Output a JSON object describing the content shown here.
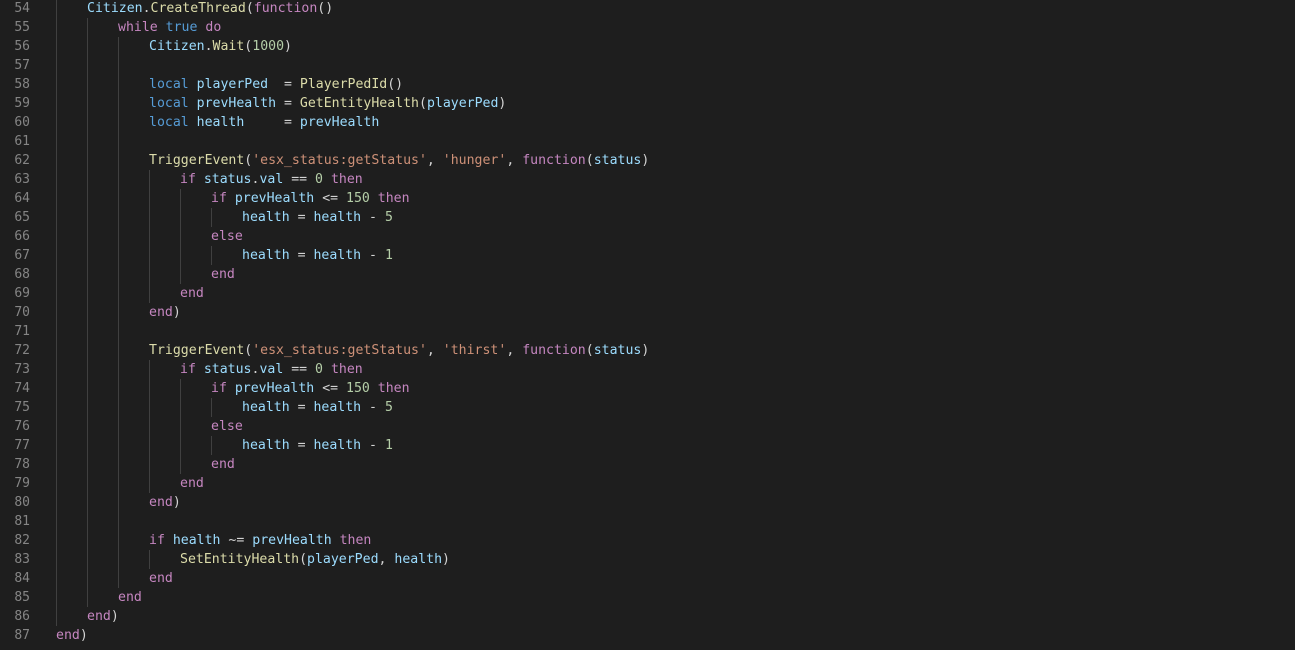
{
  "editor": {
    "theme": {
      "background": "#1e1e1e",
      "line_number": "#858585",
      "keyword": "#c586c0",
      "declaration": "#569cd6",
      "function": "#dcdcaa",
      "variable": "#9cdcfe",
      "string": "#ce9178",
      "number": "#b5cea8",
      "punctuation": "#d4d4d4"
    },
    "lines": [
      {
        "n": "54",
        "indent": 1,
        "tokens": [
          {
            "t": "Citizen",
            "c": "var"
          },
          {
            "t": ".",
            "c": "p"
          },
          {
            "t": "CreateThread",
            "c": "fn"
          },
          {
            "t": "(",
            "c": "p"
          },
          {
            "t": "function",
            "c": "kw"
          },
          {
            "t": "()",
            "c": "p"
          }
        ]
      },
      {
        "n": "55",
        "indent": 2,
        "tokens": [
          {
            "t": "while",
            "c": "kw"
          },
          {
            "t": " ",
            "c": "p"
          },
          {
            "t": "true",
            "c": "dec"
          },
          {
            "t": " ",
            "c": "p"
          },
          {
            "t": "do",
            "c": "kw"
          }
        ]
      },
      {
        "n": "56",
        "indent": 3,
        "tokens": [
          {
            "t": "Citizen",
            "c": "var"
          },
          {
            "t": ".",
            "c": "p"
          },
          {
            "t": "Wait",
            "c": "fn"
          },
          {
            "t": "(",
            "c": "p"
          },
          {
            "t": "1000",
            "c": "num"
          },
          {
            "t": ")",
            "c": "p"
          }
        ]
      },
      {
        "n": "57",
        "indent": 0,
        "tokens": []
      },
      {
        "n": "58",
        "indent": 3,
        "tokens": [
          {
            "t": "local",
            "c": "dec"
          },
          {
            "t": " ",
            "c": "p"
          },
          {
            "t": "playerPed",
            "c": "var"
          },
          {
            "t": "  = ",
            "c": "p"
          },
          {
            "t": "PlayerPedId",
            "c": "fn"
          },
          {
            "t": "()",
            "c": "p"
          }
        ]
      },
      {
        "n": "59",
        "indent": 3,
        "tokens": [
          {
            "t": "local",
            "c": "dec"
          },
          {
            "t": " ",
            "c": "p"
          },
          {
            "t": "prevHealth",
            "c": "var"
          },
          {
            "t": " = ",
            "c": "p"
          },
          {
            "t": "GetEntityHealth",
            "c": "fn"
          },
          {
            "t": "(",
            "c": "p"
          },
          {
            "t": "playerPed",
            "c": "var"
          },
          {
            "t": ")",
            "c": "p"
          }
        ]
      },
      {
        "n": "60",
        "indent": 3,
        "tokens": [
          {
            "t": "local",
            "c": "dec"
          },
          {
            "t": " ",
            "c": "p"
          },
          {
            "t": "health",
            "c": "var"
          },
          {
            "t": "     = ",
            "c": "p"
          },
          {
            "t": "prevHealth",
            "c": "var"
          }
        ]
      },
      {
        "n": "61",
        "indent": 0,
        "tokens": []
      },
      {
        "n": "62",
        "indent": 3,
        "tokens": [
          {
            "t": "TriggerEvent",
            "c": "fn"
          },
          {
            "t": "(",
            "c": "p"
          },
          {
            "t": "'esx_status:getStatus'",
            "c": "str"
          },
          {
            "t": ", ",
            "c": "p"
          },
          {
            "t": "'hunger'",
            "c": "str"
          },
          {
            "t": ", ",
            "c": "p"
          },
          {
            "t": "function",
            "c": "kw"
          },
          {
            "t": "(",
            "c": "p"
          },
          {
            "t": "status",
            "c": "var"
          },
          {
            "t": ")",
            "c": "p"
          }
        ]
      },
      {
        "n": "63",
        "indent": 4,
        "tokens": [
          {
            "t": "if",
            "c": "kw"
          },
          {
            "t": " ",
            "c": "p"
          },
          {
            "t": "status",
            "c": "var"
          },
          {
            "t": ".",
            "c": "p"
          },
          {
            "t": "val",
            "c": "var"
          },
          {
            "t": " == ",
            "c": "p"
          },
          {
            "t": "0",
            "c": "num"
          },
          {
            "t": " ",
            "c": "p"
          },
          {
            "t": "then",
            "c": "kw"
          }
        ]
      },
      {
        "n": "64",
        "indent": 5,
        "tokens": [
          {
            "t": "if",
            "c": "kw"
          },
          {
            "t": " ",
            "c": "p"
          },
          {
            "t": "prevHealth",
            "c": "var"
          },
          {
            "t": " <= ",
            "c": "p"
          },
          {
            "t": "150",
            "c": "num"
          },
          {
            "t": " ",
            "c": "p"
          },
          {
            "t": "then",
            "c": "kw"
          }
        ]
      },
      {
        "n": "65",
        "indent": 6,
        "tokens": [
          {
            "t": "health",
            "c": "var"
          },
          {
            "t": " = ",
            "c": "p"
          },
          {
            "t": "health",
            "c": "var"
          },
          {
            "t": " - ",
            "c": "p"
          },
          {
            "t": "5",
            "c": "num"
          }
        ]
      },
      {
        "n": "66",
        "indent": 5,
        "tokens": [
          {
            "t": "else",
            "c": "kw"
          }
        ]
      },
      {
        "n": "67",
        "indent": 6,
        "tokens": [
          {
            "t": "health",
            "c": "var"
          },
          {
            "t": " = ",
            "c": "p"
          },
          {
            "t": "health",
            "c": "var"
          },
          {
            "t": " - ",
            "c": "p"
          },
          {
            "t": "1",
            "c": "num"
          }
        ]
      },
      {
        "n": "68",
        "indent": 5,
        "tokens": [
          {
            "t": "end",
            "c": "kw"
          }
        ]
      },
      {
        "n": "69",
        "indent": 4,
        "tokens": [
          {
            "t": "end",
            "c": "kw"
          }
        ]
      },
      {
        "n": "70",
        "indent": 3,
        "tokens": [
          {
            "t": "end",
            "c": "kw"
          },
          {
            "t": ")",
            "c": "p"
          }
        ]
      },
      {
        "n": "71",
        "indent": 0,
        "tokens": []
      },
      {
        "n": "72",
        "indent": 3,
        "tokens": [
          {
            "t": "TriggerEvent",
            "c": "fn"
          },
          {
            "t": "(",
            "c": "p"
          },
          {
            "t": "'esx_status:getStatus'",
            "c": "str"
          },
          {
            "t": ", ",
            "c": "p"
          },
          {
            "t": "'thirst'",
            "c": "str"
          },
          {
            "t": ", ",
            "c": "p"
          },
          {
            "t": "function",
            "c": "kw"
          },
          {
            "t": "(",
            "c": "p"
          },
          {
            "t": "status",
            "c": "var"
          },
          {
            "t": ")",
            "c": "p"
          }
        ]
      },
      {
        "n": "73",
        "indent": 4,
        "tokens": [
          {
            "t": "if",
            "c": "kw"
          },
          {
            "t": " ",
            "c": "p"
          },
          {
            "t": "status",
            "c": "var"
          },
          {
            "t": ".",
            "c": "p"
          },
          {
            "t": "val",
            "c": "var"
          },
          {
            "t": " == ",
            "c": "p"
          },
          {
            "t": "0",
            "c": "num"
          },
          {
            "t": " ",
            "c": "p"
          },
          {
            "t": "then",
            "c": "kw"
          }
        ]
      },
      {
        "n": "74",
        "indent": 5,
        "tokens": [
          {
            "t": "if",
            "c": "kw"
          },
          {
            "t": " ",
            "c": "p"
          },
          {
            "t": "prevHealth",
            "c": "var"
          },
          {
            "t": " <= ",
            "c": "p"
          },
          {
            "t": "150",
            "c": "num"
          },
          {
            "t": " ",
            "c": "p"
          },
          {
            "t": "then",
            "c": "kw"
          }
        ]
      },
      {
        "n": "75",
        "indent": 6,
        "tokens": [
          {
            "t": "health",
            "c": "var"
          },
          {
            "t": " = ",
            "c": "p"
          },
          {
            "t": "health",
            "c": "var"
          },
          {
            "t": " - ",
            "c": "p"
          },
          {
            "t": "5",
            "c": "num"
          }
        ]
      },
      {
        "n": "76",
        "indent": 5,
        "tokens": [
          {
            "t": "else",
            "c": "kw"
          }
        ]
      },
      {
        "n": "77",
        "indent": 6,
        "tokens": [
          {
            "t": "health",
            "c": "var"
          },
          {
            "t": " = ",
            "c": "p"
          },
          {
            "t": "health",
            "c": "var"
          },
          {
            "t": " - ",
            "c": "p"
          },
          {
            "t": "1",
            "c": "num"
          }
        ]
      },
      {
        "n": "78",
        "indent": 5,
        "tokens": [
          {
            "t": "end",
            "c": "kw"
          }
        ]
      },
      {
        "n": "79",
        "indent": 4,
        "tokens": [
          {
            "t": "end",
            "c": "kw"
          }
        ]
      },
      {
        "n": "80",
        "indent": 3,
        "tokens": [
          {
            "t": "end",
            "c": "kw"
          },
          {
            "t": ")",
            "c": "p"
          }
        ]
      },
      {
        "n": "81",
        "indent": 0,
        "tokens": []
      },
      {
        "n": "82",
        "indent": 3,
        "tokens": [
          {
            "t": "if",
            "c": "kw"
          },
          {
            "t": " ",
            "c": "p"
          },
          {
            "t": "health",
            "c": "var"
          },
          {
            "t": " ~= ",
            "c": "p"
          },
          {
            "t": "prevHealth",
            "c": "var"
          },
          {
            "t": " ",
            "c": "p"
          },
          {
            "t": "then",
            "c": "kw"
          }
        ]
      },
      {
        "n": "83",
        "indent": 4,
        "tokens": [
          {
            "t": "SetEntityHealth",
            "c": "fn"
          },
          {
            "t": "(",
            "c": "p"
          },
          {
            "t": "playerPed",
            "c": "var"
          },
          {
            "t": ", ",
            "c": "p"
          },
          {
            "t": "health",
            "c": "var"
          },
          {
            "t": ")",
            "c": "p"
          }
        ]
      },
      {
        "n": "84",
        "indent": 3,
        "tokens": [
          {
            "t": "end",
            "c": "kw"
          }
        ]
      },
      {
        "n": "85",
        "indent": 2,
        "tokens": [
          {
            "t": "end",
            "c": "kw"
          }
        ]
      },
      {
        "n": "86",
        "indent": 1,
        "tokens": [
          {
            "t": "end",
            "c": "kw"
          },
          {
            "t": ")",
            "c": "p"
          }
        ]
      },
      {
        "n": "87",
        "indent": 0,
        "tokens": [
          {
            "t": "end",
            "c": "kw"
          },
          {
            "t": ")",
            "c": "p"
          }
        ]
      }
    ]
  }
}
